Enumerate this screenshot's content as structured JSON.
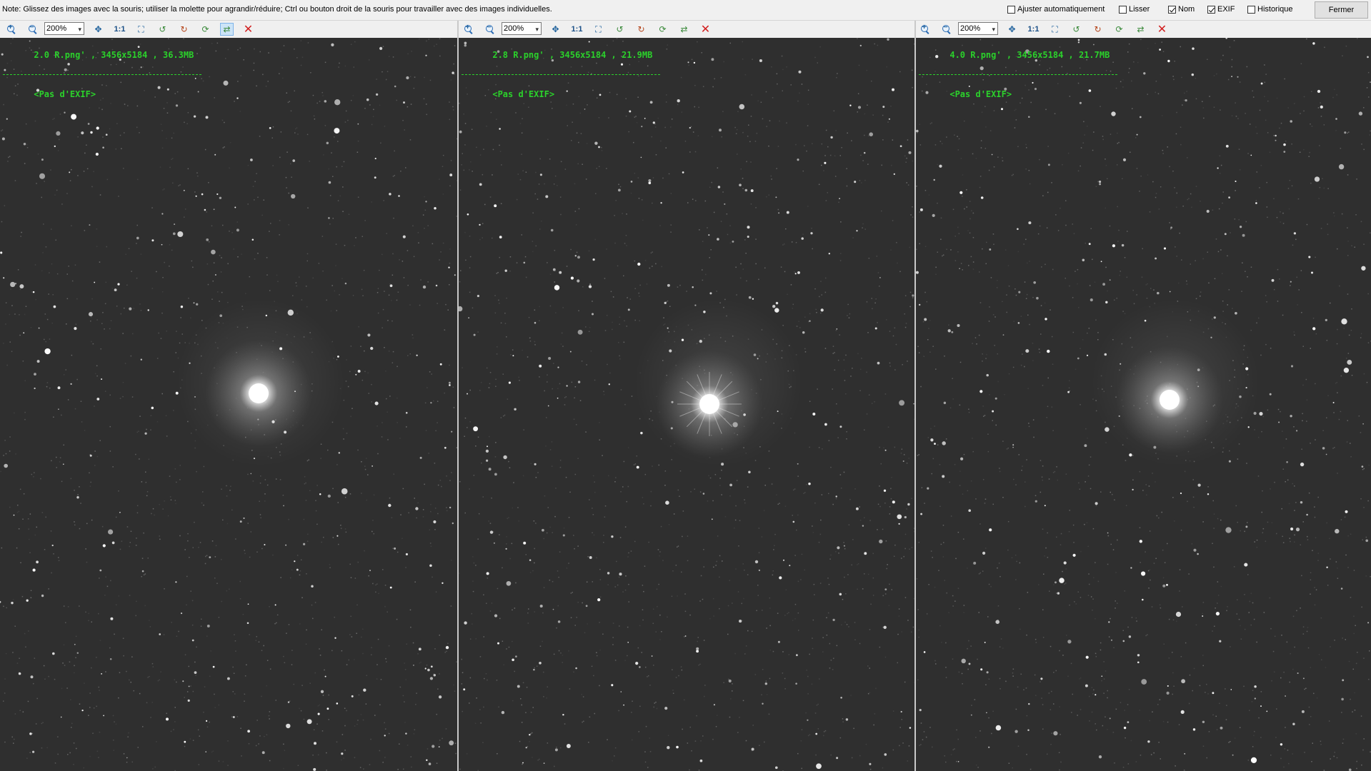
{
  "topbar": {
    "note": "Note: Glissez des images avec la souris; utiliser la molette pour agrandir/réduire; Ctrl ou bouton droit de la souris pour travailler avec des images individuelles.",
    "options": [
      {
        "label": "Ajuster automatiquement",
        "checked": false
      },
      {
        "label": "Lisser",
        "checked": false
      },
      {
        "label": "Nom",
        "checked": true
      },
      {
        "label": "EXIF",
        "checked": true
      },
      {
        "label": "Historique",
        "checked": false
      }
    ],
    "close_label": "Fermer"
  },
  "toolbar": {
    "zoom_value": "200%",
    "one_to_one": "1:1"
  },
  "panels": [
    {
      "file_info": "2.0 R.png' , 3456x5184 , 36.3MB",
      "exif": "<Pas d'EXIF>"
    },
    {
      "file_info": "2.8 R.png' , 3456x5184 , 21.9MB",
      "exif": "<Pas d'EXIF>"
    },
    {
      "file_info": "4.0 R.png' , 3456x5184 , 21.7MB",
      "exif": "<Pas d'EXIF>"
    }
  ],
  "colors": {
    "overlay_text": "#2bd12b",
    "close_icon": "#d21f1f",
    "sky_background": "#2f2f2f"
  },
  "icons": [
    "zoom-in-icon",
    "zoom-out-icon",
    "center-icon",
    "fit-icon",
    "rotate-left-icon",
    "rotate-right-icon",
    "refresh-icon",
    "sync-icon",
    "close-icon"
  ]
}
